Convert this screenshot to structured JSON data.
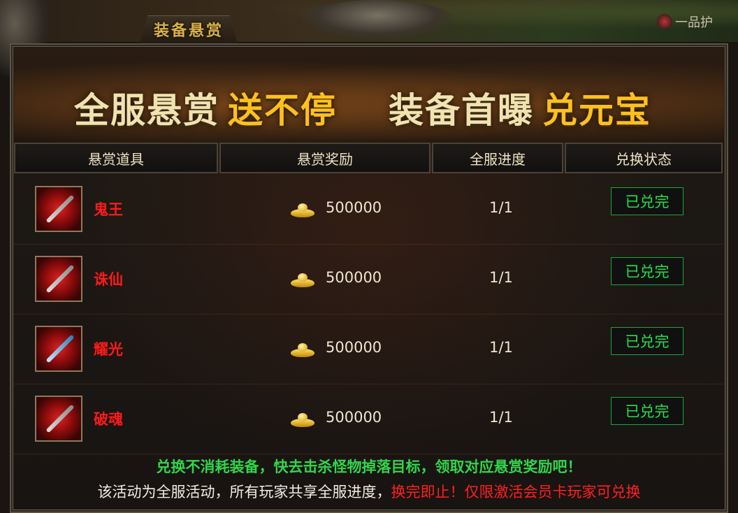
{
  "window": {
    "title": "装备悬赏",
    "top_right_text": "一品护"
  },
  "banner": {
    "part1": "全服悬赏",
    "part2": "送不停",
    "part3": "装备首曝",
    "part4": "兑元宝"
  },
  "table": {
    "headers": [
      "悬赏道具",
      "悬赏奖励",
      "全服进度",
      "兑换状态"
    ],
    "rows": [
      {
        "item": "鬼王",
        "reward": "500000",
        "progress": "1/1",
        "status": "已兑完",
        "icon": "red-blade-icon"
      },
      {
        "item": "诛仙",
        "reward": "500000",
        "progress": "1/1",
        "status": "已兑完",
        "icon": "sword-icon"
      },
      {
        "item": "耀光",
        "reward": "500000",
        "progress": "1/1",
        "status": "已兑完",
        "icon": "blue-sword-icon"
      },
      {
        "item": "破魂",
        "reward": "500000",
        "progress": "1/1",
        "status": "已兑完",
        "icon": "spear-icon"
      }
    ]
  },
  "footer": {
    "line1": "兑换不消耗装备，快去击杀怪物掉落目标，领取对应悬赏奖励吧！",
    "line2_a": "该活动为全服活动，所有玩家共享全服进度，",
    "line2_b": "换完即止！",
    "line2_c": "仅限激活会员卡玩家可兑换"
  },
  "colors": {
    "gold": "#ffc01e",
    "red": "#ff1a1a",
    "green": "#27e04a"
  }
}
